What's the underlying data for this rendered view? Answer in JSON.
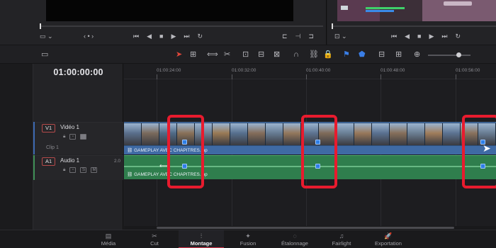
{
  "viewer": {
    "left_controls": [
      "⏮",
      "◀",
      "■",
      "▶",
      "⏭",
      "↻"
    ],
    "right_controls": [
      "⏮",
      "◀",
      "■",
      "▶",
      "⏭",
      "↻"
    ]
  },
  "toolbar": {
    "tools": [
      {
        "name": "selection-arrow-icon",
        "glyph": "➤"
      },
      {
        "name": "trim-tool-icon",
        "glyph": "⊞"
      },
      {
        "name": "dynamic-trim-icon",
        "glyph": "⟺"
      },
      {
        "name": "blade-tool-icon",
        "glyph": "✂"
      },
      {
        "name": "insert-clip-icon",
        "glyph": "⊡"
      },
      {
        "name": "overwrite-clip-icon",
        "glyph": "⊟"
      },
      {
        "name": "replace-clip-icon",
        "glyph": "⊠"
      },
      {
        "name": "snapping-icon",
        "glyph": "∩"
      },
      {
        "name": "linked-selection-icon",
        "glyph": "⛓"
      },
      {
        "name": "position-lock-icon",
        "glyph": "🔒"
      },
      {
        "name": "flag-icon",
        "glyph": "⚑"
      },
      {
        "name": "marker-icon",
        "glyph": "⬟"
      },
      {
        "name": "zoom-detail-icon",
        "glyph": "⊟"
      },
      {
        "name": "zoom-custom-icon",
        "glyph": "⊞"
      },
      {
        "name": "zoom-full-icon",
        "glyph": "⊕"
      }
    ]
  },
  "timeline": {
    "timecode": "01:00:00:00",
    "ruler_labels": [
      "01:00:24:00",
      "01:00:32:00",
      "01:00:40:00",
      "01:00:48:00",
      "01:00:56:00"
    ]
  },
  "tracks": {
    "video": {
      "badge": "V1",
      "name": "Vidéo 1",
      "clip_label": "Clip 1"
    },
    "audio": {
      "badge": "A1",
      "name": "Audio 1",
      "channel": "2.0",
      "solo": "S",
      "mute": "M"
    }
  },
  "clips": {
    "video_clip_name": "GAMEPLAY AVEC CHAPITRES.mp",
    "audio_clip_name": "GAMEPLAY AVEC CHAPITRES.mp"
  },
  "pages": [
    {
      "label": "Média",
      "icon": "▤",
      "active": false
    },
    {
      "label": "Cut",
      "icon": "✂",
      "active": false
    },
    {
      "label": "Montage",
      "icon": "⫶",
      "active": true
    },
    {
      "label": "Fusion",
      "icon": "✦",
      "active": false
    },
    {
      "label": "Étalonnage",
      "icon": "◌",
      "active": false
    },
    {
      "label": "Fairlight",
      "icon": "♫",
      "active": false
    },
    {
      "label": "Exportation",
      "icon": "🚀",
      "active": false
    }
  ],
  "colors": {
    "accent_red": "#e81b2e",
    "video_clip": "#3f6aa4",
    "audio_clip": "#2f7e4d",
    "keyframe": "#2f7fe6"
  }
}
